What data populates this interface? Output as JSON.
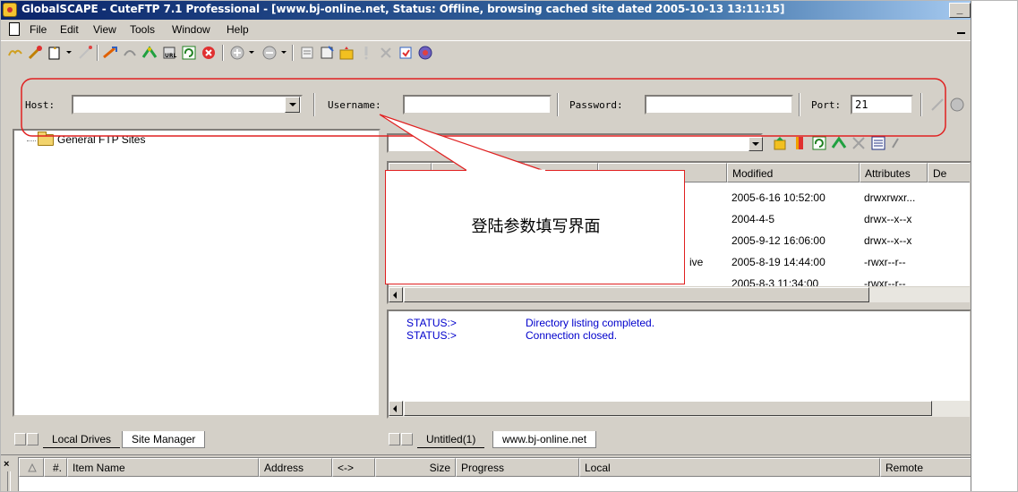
{
  "window": {
    "title": "GlobalSCAPE - CuteFTP 7.1 Professional - [www.bj-online.net, Status: Offline, browsing cached site dated 2005-10-13 13:11:15]",
    "minimize_glyph": "_"
  },
  "menu": {
    "items": [
      "File",
      "Edit",
      "View",
      "Tools",
      "Window",
      "Help"
    ]
  },
  "quick_connect": {
    "host_label": "Host:",
    "host_value": "",
    "username_label": "Username:",
    "username_value": "",
    "password_label": "Password:",
    "password_value": "",
    "port_label": "Port:",
    "port_value": "21"
  },
  "site_tree": {
    "root_label": "General FTP Sites"
  },
  "left_tabs": [
    "Local Drives",
    "Site Manager"
  ],
  "remote_list": {
    "columns": [
      "Modified",
      "Attributes",
      "De"
    ],
    "rows": [
      {
        "name_tail": "",
        "modified": "2005-6-16 10:52:00",
        "attributes": "drwxrwxr..."
      },
      {
        "name_tail": "",
        "modified": "2004-4-5",
        "attributes": "drwx--x--x"
      },
      {
        "name_tail": "",
        "modified": "2005-9-12 16:06:00",
        "attributes": "drwx--x--x"
      },
      {
        "name_tail": "ive",
        "modified": "2005-8-19 14:44:00",
        "attributes": "-rwxr--r--"
      },
      {
        "name_tail": "",
        "modified": "2005-8-3 11:34:00",
        "attributes": "-rwxr--r--"
      }
    ]
  },
  "log": {
    "lines": [
      {
        "prefix": "STATUS:>",
        "message": "Directory listing completed."
      },
      {
        "prefix": "STATUS:>",
        "message": "Connection closed."
      }
    ]
  },
  "right_tabs": [
    "Untitled(1)",
    "www.bj-online.net"
  ],
  "queue": {
    "close_glyph": "×",
    "columns": [
      "#.",
      "Item Name",
      "Address",
      "<->",
      "Size",
      "Progress",
      "Local",
      "Remote"
    ]
  },
  "callout": {
    "text": "登陆参数填写界面",
    "color": "#e02020"
  },
  "colors": {
    "titlebar_start": "#0a246a",
    "titlebar_end": "#a6caf0",
    "log_text": "#0000cc",
    "chrome": "#d4d0c8"
  }
}
